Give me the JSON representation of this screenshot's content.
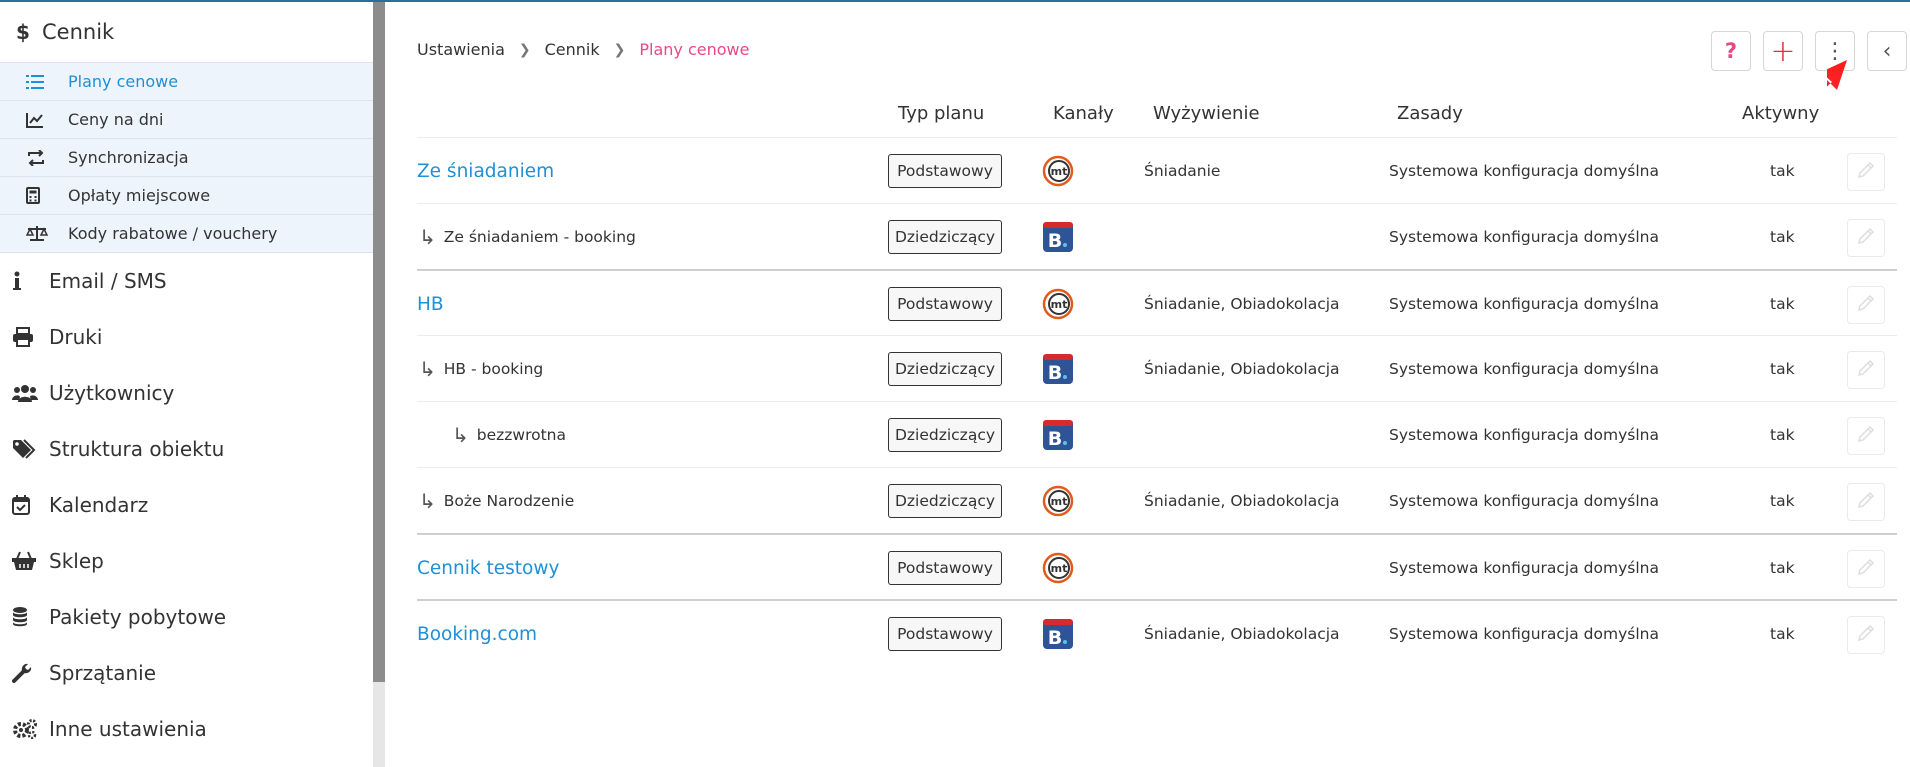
{
  "sidebar": {
    "section": {
      "label": "Cennik",
      "icon": "dollar-icon"
    },
    "sub_items": [
      {
        "label": "Plany cenowe",
        "icon": "list-icon",
        "active": true
      },
      {
        "label": "Ceny na dni",
        "icon": "chart-line-icon"
      },
      {
        "label": "Synchronizacja",
        "icon": "sync-icon"
      },
      {
        "label": "Opłaty miejscowe",
        "icon": "calculator-icon"
      },
      {
        "label": "Kody rabatowe / vouchery",
        "icon": "scale-icon"
      }
    ],
    "items": [
      {
        "label": "Email / SMS",
        "icon": "info-icon"
      },
      {
        "label": "Druki",
        "icon": "printer-icon"
      },
      {
        "label": "Użytkownicy",
        "icon": "users-icon"
      },
      {
        "label": "Struktura obiektu",
        "icon": "tags-icon"
      },
      {
        "label": "Kalendarz",
        "icon": "calendar-check-icon"
      },
      {
        "label": "Sklep",
        "icon": "basket-icon"
      },
      {
        "label": "Pakiety pobytowe",
        "icon": "database-icon"
      },
      {
        "label": "Sprzątanie",
        "icon": "wrench-icon"
      },
      {
        "label": "Inne ustawienia",
        "icon": "cogs-icon"
      }
    ]
  },
  "breadcrumb": [
    "Ustawienia",
    "Cennik",
    "Plany cenowe"
  ],
  "toolbar": {
    "help": "?",
    "add": "+",
    "more": "⋮",
    "collapse": "‹"
  },
  "table": {
    "headers": {
      "type": "Typ planu",
      "channels": "Kanały",
      "meals": "Wyżywienie",
      "rules": "Zasady",
      "active": "Aktywny"
    },
    "rows": [
      {
        "name": "Ze śniadaniem",
        "level": 0,
        "type": "Podstawowy",
        "channel": "mt",
        "meals": "Śniadanie",
        "rules": "Systemowa konfiguracja domyślna",
        "active": "tak"
      },
      {
        "name": "Ze śniadaniem - booking",
        "level": 1,
        "type": "Dziedziczący",
        "channel": "booking",
        "meals": "",
        "rules": "Systemowa konfiguracja domyślna",
        "active": "tak"
      },
      {
        "name": "HB",
        "level": 0,
        "type": "Podstawowy",
        "channel": "mt",
        "meals": "Śniadanie, Obiadokolacja",
        "rules": "Systemowa konfiguracja domyślna",
        "active": "tak"
      },
      {
        "name": "HB - booking",
        "level": 1,
        "type": "Dziedziczący",
        "channel": "booking",
        "meals": "Śniadanie, Obiadokolacja",
        "rules": "Systemowa konfiguracja domyślna",
        "active": "tak"
      },
      {
        "name": "bezzwrotna",
        "level": 2,
        "type": "Dziedziczący",
        "channel": "booking",
        "meals": "",
        "rules": "Systemowa konfiguracja domyślna",
        "active": "tak"
      },
      {
        "name": "Boże Narodzenie",
        "level": 1,
        "type": "Dziedziczący",
        "channel": "mt",
        "meals": "Śniadanie, Obiadokolacja",
        "rules": "Systemowa konfiguracja domyślna",
        "active": "tak"
      },
      {
        "name": "Cennik testowy",
        "level": 0,
        "type": "Podstawowy",
        "channel": "mt",
        "meals": "",
        "rules": "Systemowa konfiguracja domyślna",
        "active": "tak"
      },
      {
        "name": "Booking.com",
        "level": 0,
        "type": "Podstawowy",
        "channel": "booking",
        "meals": "Śniadanie, Obiadokolacja",
        "rules": "Systemowa konfiguracja domyślna",
        "active": "tak"
      }
    ]
  },
  "colors": {
    "accent": "#1e90d6",
    "breadcrumb_current": "#e64a86",
    "add_button": "#e0322e",
    "pointer_arrow": "#e8262b"
  }
}
